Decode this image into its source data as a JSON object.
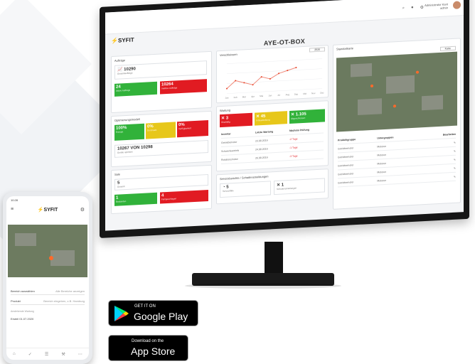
{
  "dashboard": {
    "title": "AYE-OT-BOX",
    "brand": "SYFIT",
    "user_name": "Administrator Kant",
    "user_role": "admin",
    "kpi": {
      "section_label": "Aufträge",
      "total_value": "10290",
      "total_label": "Gesamtaufträge",
      "ok_value": "24",
      "ok_label": "Aktive Aufträge",
      "fail_value": "10264",
      "fail_label": "Inaktive Aufträge"
    },
    "optimize": {
      "section_label": "Optimierungsmodell",
      "t1_value": "100%",
      "t1_label": "Energie",
      "t2_value": "0%",
      "t2_label": "Durchsatz",
      "t3_value": "0%",
      "t3_label": "Verfügbarkeit",
      "count_value": "10267 VON 10298",
      "count_label": "Geräte optimiert"
    },
    "alerts": {
      "section_label": "Sale",
      "top_value": "5",
      "top_label": "Gesamt",
      "ok_value": "1",
      "ok_label": "Bestanden",
      "fail_value": "4",
      "fail_label": "Fehlgeschlagen"
    },
    "chart": {
      "label": "Verschleissen",
      "select": "2020"
    },
    "maintenance": {
      "section_label": "Wartung",
      "t1_value": "3",
      "t1_label": "Überfällig",
      "t2_value": "45",
      "t2_label": "In Bearbeitung",
      "t3_value": "1.105",
      "t3_label": "Abgeschlossen",
      "headers": [
        "Inventar",
        "Letzte Wartung",
        "Nächste Prüfung"
      ],
      "rows": [
        [
          "Getriebemotor",
          "23.08.2019",
          "-2 Tage"
        ],
        [
          "Schwenkantrieb",
          "24.08.2019",
          "-1 Tage"
        ],
        [
          "Rotationsmotor",
          "26.08.2019",
          "-3 Tage"
        ]
      ]
    },
    "service": {
      "section_label": "Serviceberichte / Schadensmeldungen",
      "v1": "5",
      "l1": "Servicefälle",
      "v2": "1",
      "l2": "Schadensmeldungen"
    },
    "map_panel": {
      "label": "Standortkarte",
      "select": "Karte",
      "headers": [
        "Produktgruppe",
        "Untergruppen",
        "Bearbeiten"
      ],
      "rows": [
        [
          "Getriebemotor",
          "Motoren"
        ],
        [
          "Getriebemotor",
          "Motoren"
        ],
        [
          "Getriebemotor",
          "Motoren"
        ],
        [
          "Getriebemotor",
          "Motoren"
        ],
        [
          "Getriebemotor",
          "Motoren"
        ]
      ]
    }
  },
  "phone": {
    "time": "10:28",
    "brand": "SYFIT",
    "field1_label": "Bereich auswählen",
    "field1_value": "Alle Bereiche anzeigen",
    "field2_label": "Produkt",
    "field2_value": "Bereich eingeben, z.B. Hamburg",
    "entry_title": "Anstehende Wartung",
    "entry_value": "Ersteil 01.07.2020"
  },
  "stores": {
    "google_small": "GET IT ON",
    "google_big": "Google Play",
    "apple_small": "Download on the",
    "apple_big": "App Store"
  },
  "chart_data": {
    "type": "line",
    "categories": [
      "Jan",
      "Feb",
      "Mär",
      "Apr",
      "Mai",
      "Jun",
      "Jul",
      "Aug",
      "Sep",
      "Okt",
      "Nov",
      "Dez"
    ],
    "values": [
      2,
      5,
      4,
      3,
      6,
      5,
      7,
      8,
      9,
      0,
      0,
      0
    ],
    "ylim": [
      0,
      12
    ]
  }
}
